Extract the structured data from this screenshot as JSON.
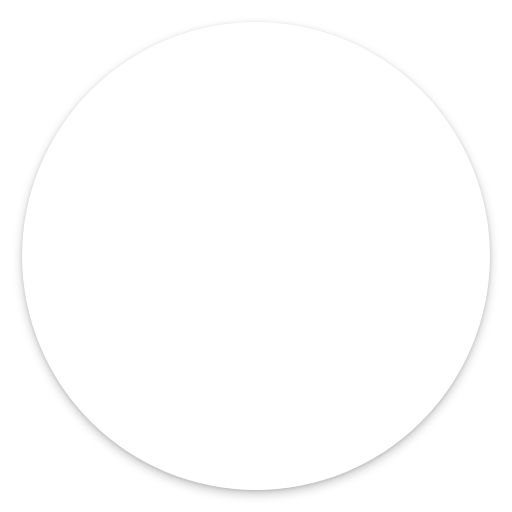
{
  "icon": {
    "name": "clipboard-icon",
    "background_color": "#ffffff",
    "accent_color": "#9a0019",
    "line_color": "#ffffff"
  }
}
